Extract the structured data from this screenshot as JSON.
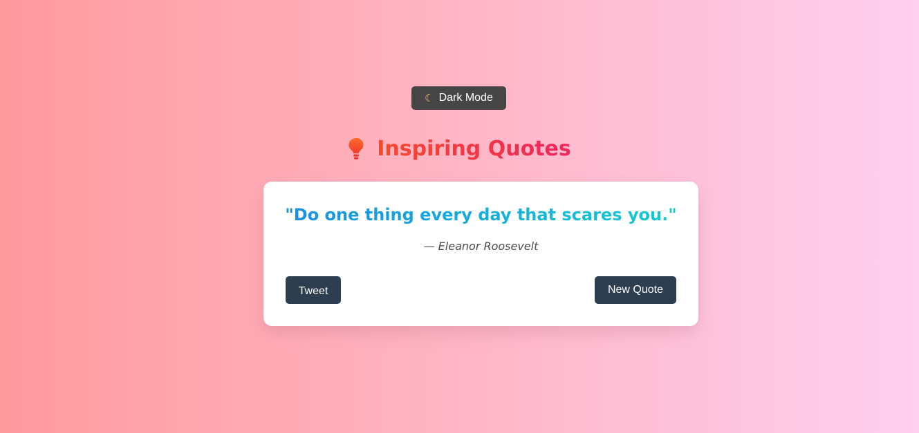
{
  "theme_toggle": {
    "icon": "moon-icon",
    "label": "Dark Mode"
  },
  "header": {
    "icon": "lightbulb-icon",
    "title": "Inspiring Quotes"
  },
  "quote_card": {
    "text": "\"Do one thing every day that scares you.\"",
    "author": "— Eleanor Roosevelt",
    "tweet_label": "Tweet",
    "new_quote_label": "New Quote"
  },
  "colors": {
    "background_start": "#ff9a9e",
    "background_end": "#fecfef",
    "title_gradient": [
      "#f44a2c",
      "#f0255f"
    ],
    "quote_gradient": [
      "#1a8fe3",
      "#13cbd1"
    ],
    "button": "#2c3e50",
    "toggle": "#454545"
  }
}
